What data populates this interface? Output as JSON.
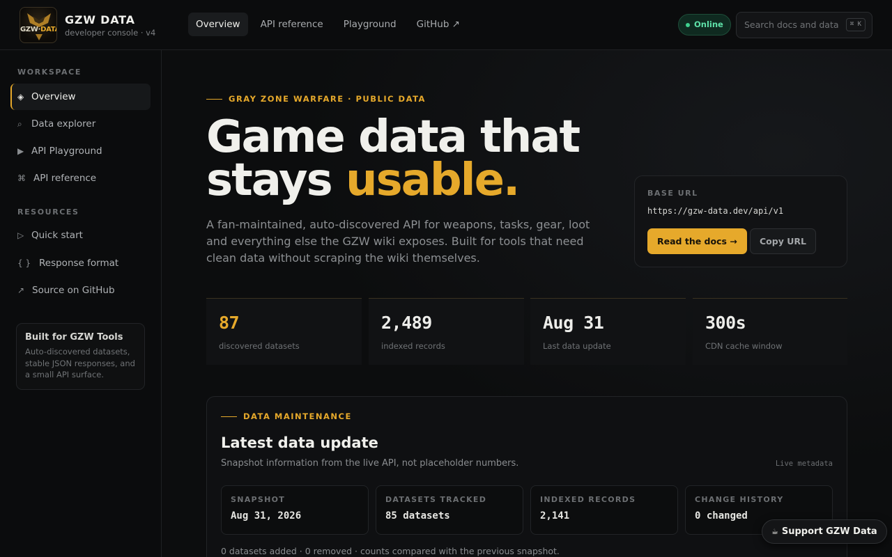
{
  "brand": {
    "logo_text_a": "GZW",
    "logo_text_b": "DATA",
    "name": "GZW DATA",
    "subtitle": "developer console · v4"
  },
  "topnav": [
    {
      "label": "Overview",
      "active": true
    },
    {
      "label": "API reference"
    },
    {
      "label": "Playground"
    },
    {
      "label": "GitHub ↗"
    }
  ],
  "status": {
    "label": "Online",
    "color": "#3fd08e"
  },
  "search": {
    "placeholder": "Search docs and data",
    "shortcut": "⌘ K"
  },
  "sidebar": {
    "workspace_heading": "WORKSPACE",
    "workspace": [
      {
        "icon": "◈",
        "icon_name": "diamond-icon",
        "label": "Overview",
        "active": true
      },
      {
        "icon": "⌕",
        "icon_name": "search-icon",
        "label": "Data explorer"
      },
      {
        "icon": "▶",
        "icon_name": "play-icon",
        "label": "API Playground"
      },
      {
        "icon": "⌘",
        "icon_name": "command-icon",
        "label": "API reference"
      }
    ],
    "resources_heading": "RESOURCES",
    "resources": [
      {
        "icon": "▷",
        "icon_name": "play-outline-icon",
        "label": "Quick start"
      },
      {
        "icon": "{ }",
        "icon_name": "braces-icon",
        "label": "Response format"
      },
      {
        "icon": "↗",
        "icon_name": "external-link-icon",
        "label": "Source on GitHub"
      }
    ],
    "card": {
      "title": "Built for GZW Tools",
      "text": "Auto-discovered datasets, stable JSON responses, and a small API surface."
    }
  },
  "hero": {
    "eyebrow": "GRAY ZONE WARFARE · PUBLIC DATA",
    "title_line1": "Game data that",
    "title_line2": "stays ",
    "title_accent": "usable.",
    "description": "A fan-maintained, auto-discovered API for weapons, tasks, gear, loot and everything else the GZW wiki exposes. Built for tools that need clean data without scraping the wiki themselves."
  },
  "base_url": {
    "label": "BASE URL",
    "value": "https://gzw-data.dev/api/v1",
    "primary_button": "Read the docs →",
    "secondary_button": "Copy URL"
  },
  "stats": [
    {
      "value": "87",
      "label": "discovered datasets",
      "highlight": true
    },
    {
      "value": "2,489",
      "label": "indexed records"
    },
    {
      "value": "Aug 31",
      "label": "Last data update"
    },
    {
      "value": "300s",
      "label": "CDN cache window"
    }
  ],
  "maintenance": {
    "eyebrow": "DATA MAINTENANCE",
    "title": "Latest data update",
    "description": "Snapshot information from the live API, not placeholder numbers.",
    "meta": "Live metadata",
    "cards": [
      {
        "label": "SNAPSHOT",
        "value": "Aug 31, 2026"
      },
      {
        "label": "DATASETS TRACKED",
        "value": "85 datasets"
      },
      {
        "label": "INDEXED RECORDS",
        "value": "2,141"
      },
      {
        "label": "CHANGE HISTORY",
        "value": "0 changed"
      }
    ],
    "footer": "0 datasets added · 0 removed · counts compared with the previous snapshot."
  },
  "support": {
    "icon": "☕",
    "label": "Support GZW Data"
  },
  "colors": {
    "accent": "#e6a92b",
    "background": "#0c0d0e",
    "online": "#3fd08e"
  }
}
